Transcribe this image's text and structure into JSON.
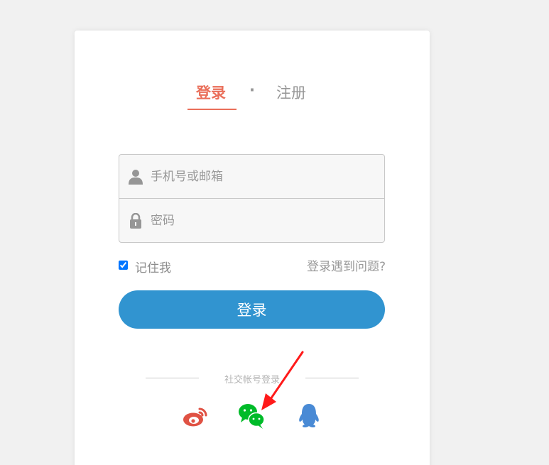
{
  "tabs": {
    "login_label": "登录",
    "separator": "·",
    "register_label": "注册"
  },
  "form": {
    "account_placeholder": "手机号或邮箱",
    "password_placeholder": "密码",
    "remember_label": "记住我",
    "remember_checked": true,
    "help_link": "登录遇到问题?",
    "submit_label": "登录"
  },
  "social": {
    "divider_text": "社交帐号登录",
    "providers": [
      "weibo-icon",
      "wechat-icon",
      "qq-icon"
    ]
  },
  "colors": {
    "accent": "#ea6f5a",
    "button": "#3194d0",
    "weibo": "#e05244",
    "wechat": "#00bb29",
    "qq": "#498ad5",
    "annotation_arrow": "#ff1a1a"
  }
}
